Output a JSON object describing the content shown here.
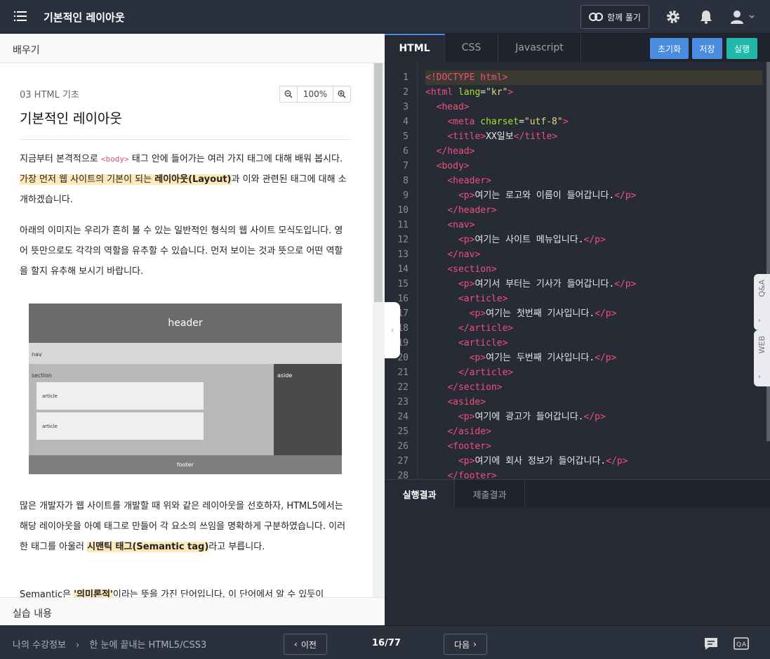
{
  "topbar": {
    "title": "기본적인 레이아웃",
    "together_label": "함께 풀기"
  },
  "left": {
    "header": "배우기",
    "breadcrumb": "03 HTML 기초",
    "zoom": "100%",
    "title": "기본적인 레이아웃",
    "p1_a": "지금부터 본격적으로 ",
    "p1_tag": "<body>",
    "p1_b": " 태그 안에 들어가는 여러 가지 태그에 대해 배워 봅시다. ",
    "p1_hl": "가장 먼저 웹 사이트의 기본이 되는 ",
    "p1_bold": "레이아웃(Layout)",
    "p1_c": "과 이와 관련된 태그에 대해 소개하겠습니다.",
    "p2": "아래의 이미지는 우리가 흔히 볼 수 있는 일반적인 형식의 웹 사이트 모식도입니다. 영어 뜻만으로도 각각의 역할을 유추할 수 있습니다. 먼저 보이는 것과 뜻으로 어떤 역할을 할지 유추해 보시기 바랍니다.",
    "diagram": {
      "header": "header",
      "nav": "nav",
      "section": "section",
      "aside": "aside",
      "article1": "article",
      "article2": "article",
      "footer": "footer"
    },
    "p3_a": "많은 개발자가 웹 사이트를 개발할 때 위와 같은 레이아웃을 선호하자, HTML5에서는 해당 레이아웃을 아예 태그로 만들어 각 요소의 쓰임을 명확하게 구분하였습니다. 이러한 태그를 아울러 ",
    "p3_bold": "시맨틱 태그(Semantic tag)",
    "p3_b": "라고 부릅니다.",
    "p4_a": "Semantic은 ",
    "p4_bold": "'의미론적'",
    "p4_b": "이라는 뜻을 가진 단어입니다. 이 단어에서 알 수 있듯이",
    "practice": "실습 내용"
  },
  "editor": {
    "tabs": [
      "HTML",
      "CSS",
      "Javascript"
    ],
    "reset_label": "초기화",
    "save_label": "저장",
    "run_label": "실행",
    "line_numbers": [
      "1",
      "2",
      "3",
      "4",
      "5",
      "6",
      "7",
      "8",
      "9",
      "10",
      "11",
      "12",
      "13",
      "14",
      "15",
      "16",
      "17",
      "18",
      "19",
      "20",
      "21",
      "22",
      "23",
      "24",
      "25",
      "26",
      "27",
      "28"
    ],
    "p_text": {
      "l4_charset": "\"utf-8\"",
      "l5_title": "XX일보",
      "l9": "여기는 로고와 이름이 들어갑니다.",
      "l12": "여기는 사이트 메뉴입니다.",
      "l15": "여기서 부터는 기사가 들어갑니다.",
      "l17": "여기는 첫번째 기사입니다.",
      "l20": "여기는 두번째 기사입니다.",
      "l24": "여기에 광고가 들어갑니다.",
      "l27": "여기에 회사 정보가 들어갑니다."
    },
    "result_tabs": [
      "실행결과",
      "제출결과"
    ]
  },
  "side_tabs": [
    "Q&A",
    "WEB"
  ],
  "bottombar": {
    "crumb_1": "나의 수강정보",
    "crumb_sep": "›",
    "crumb_2": "한 눈에 끝내는 HTML5/CSS3",
    "prev_label": "이전",
    "next_label": "다음",
    "page": "16/77"
  },
  "colors": {
    "accent_blue": "#4a8de0",
    "run_teal": "#1fb8a9",
    "tag_red": "#f0507a",
    "attr_green": "#a6e22e",
    "string_yellow": "#e6db74"
  }
}
